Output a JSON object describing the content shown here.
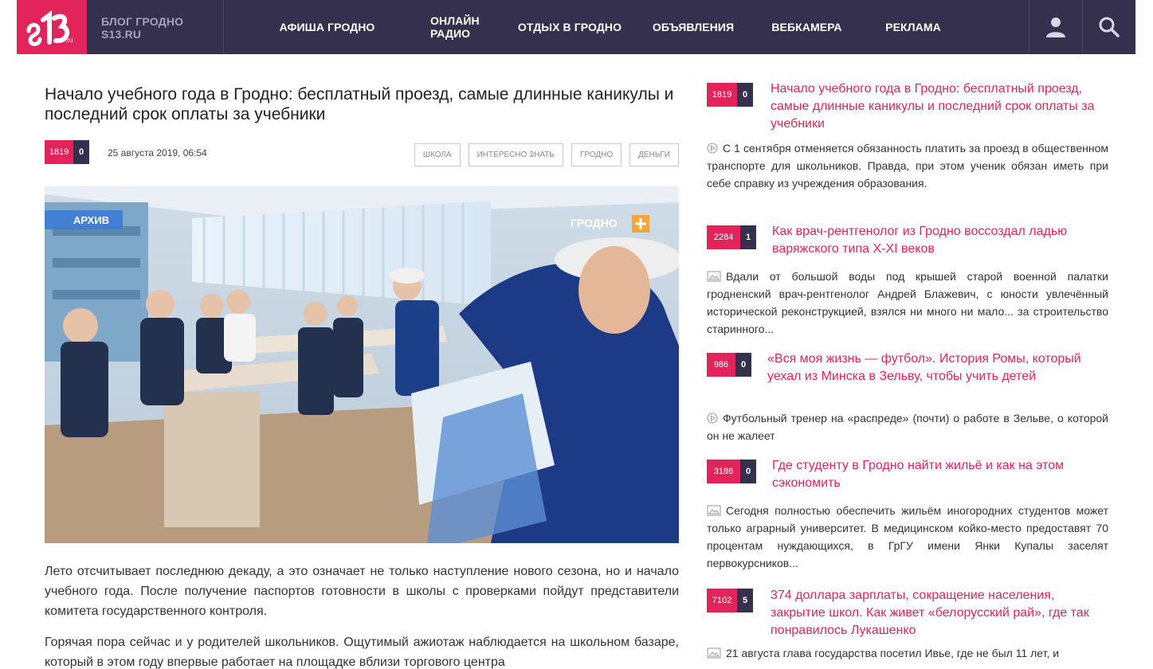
{
  "header": {
    "logo_text": "s13.ru",
    "brand_line1": "БЛОГ ГРОДНО",
    "brand_line2": "S13.RU",
    "nav": [
      "АФИША ГРОДНО",
      "ОНЛАЙН РАДИО",
      "ОТДЫХ В ГРОДНО",
      "ОБЪЯВЛЕНИЯ",
      "ВЕБКАМЕРА",
      "РЕКЛАМА"
    ],
    "user_icon": "user-icon",
    "search_icon": "search-icon"
  },
  "article": {
    "title": "Начало учебного года в Гродно: бесплатный проезд, самые длинные каникулы и последний срок оплаты за учебники",
    "views": "1819",
    "comments": "0",
    "date": "25 августа 2019, 06:54",
    "tags": [
      "ШКОЛА",
      "ИНТЕРЕСНО ЗНАТЬ",
      "ГРОДНО",
      "ДЕНЬГИ"
    ],
    "photo_badge_archive": "АРХИВ",
    "photo_badge_channel": "ГРОДНО",
    "paragraphs": [
      "Лето отсчитывает последнюю декаду, а это означает не только наступление нового сезона, но и начало учебного года. После получение паспортов готовности в школы с проверками пойдут представители комитета государственного контроля.",
      "Горячая пора сейчас и у родителей школьников. Ощутимый  ажиотаж наблюдается  на школьном базаре, который в этом году впервые работает на площадке вблизи торгового центра"
    ]
  },
  "sidebar": [
    {
      "views": "1819",
      "comments": "0",
      "title": "Начало учебного года в Гродно: бесплатный проезд, самые длинные каникулы и последний срок оплаты за учебники",
      "icon": "video-icon",
      "desc": "С 1 сентября отменяется обязанность платить за проезд в общественном транспорте для школьников. Правда, при этом ученик обязан иметь при себе справку из учреждения образования."
    },
    {
      "views": "2284",
      "comments": "1",
      "title": "Как врач-рентгенолог из Гродно воссоздал ладью варяжского типа X-XI веков",
      "icon": "image-icon",
      "desc": "Вдали от большой воды под крышей старой военной палатки гродненский врач-рентгенолог Андрей Блажевич, с юности увлечённый исторической реконструкцией, взялся ни много ни мало... за строительство старинного..."
    },
    {
      "views": "986",
      "comments": "0",
      "title": "«Вся моя жизнь — футбол». История Ромы, который уехал из Минска в Зельву, чтобы учить детей",
      "icon": "video-icon",
      "desc": "Футбольный тренер на «распреде» (почти) о работе в Зельве, о которой он не жалеет"
    },
    {
      "views": "3186",
      "comments": "0",
      "title": "Где студенту в Гродно найти жильё и как на этом сэкономить",
      "icon": "image-icon",
      "desc": "Сегодня полностью обеспечить жильём иногородних студентов может только аграрный университет. В медицинском койко-место предоставят 70 процентам нуждающихся, в ГрГУ имени Янки Купалы заселят первокурсников..."
    },
    {
      "views": "7102",
      "comments": "5",
      "title": "374 доллара зарплаты, сокращение населения, закрытие школ. Как живет «белорусский рай», где так понравилось Лукашенко",
      "icon": "image-icon",
      "desc": "21 августа глава государства посетил Ивье, где не был 11 лет, и"
    }
  ],
  "colors": {
    "accent": "#e3245a",
    "header_bg": "#35304d",
    "brand_text": "#a6a2bd"
  }
}
